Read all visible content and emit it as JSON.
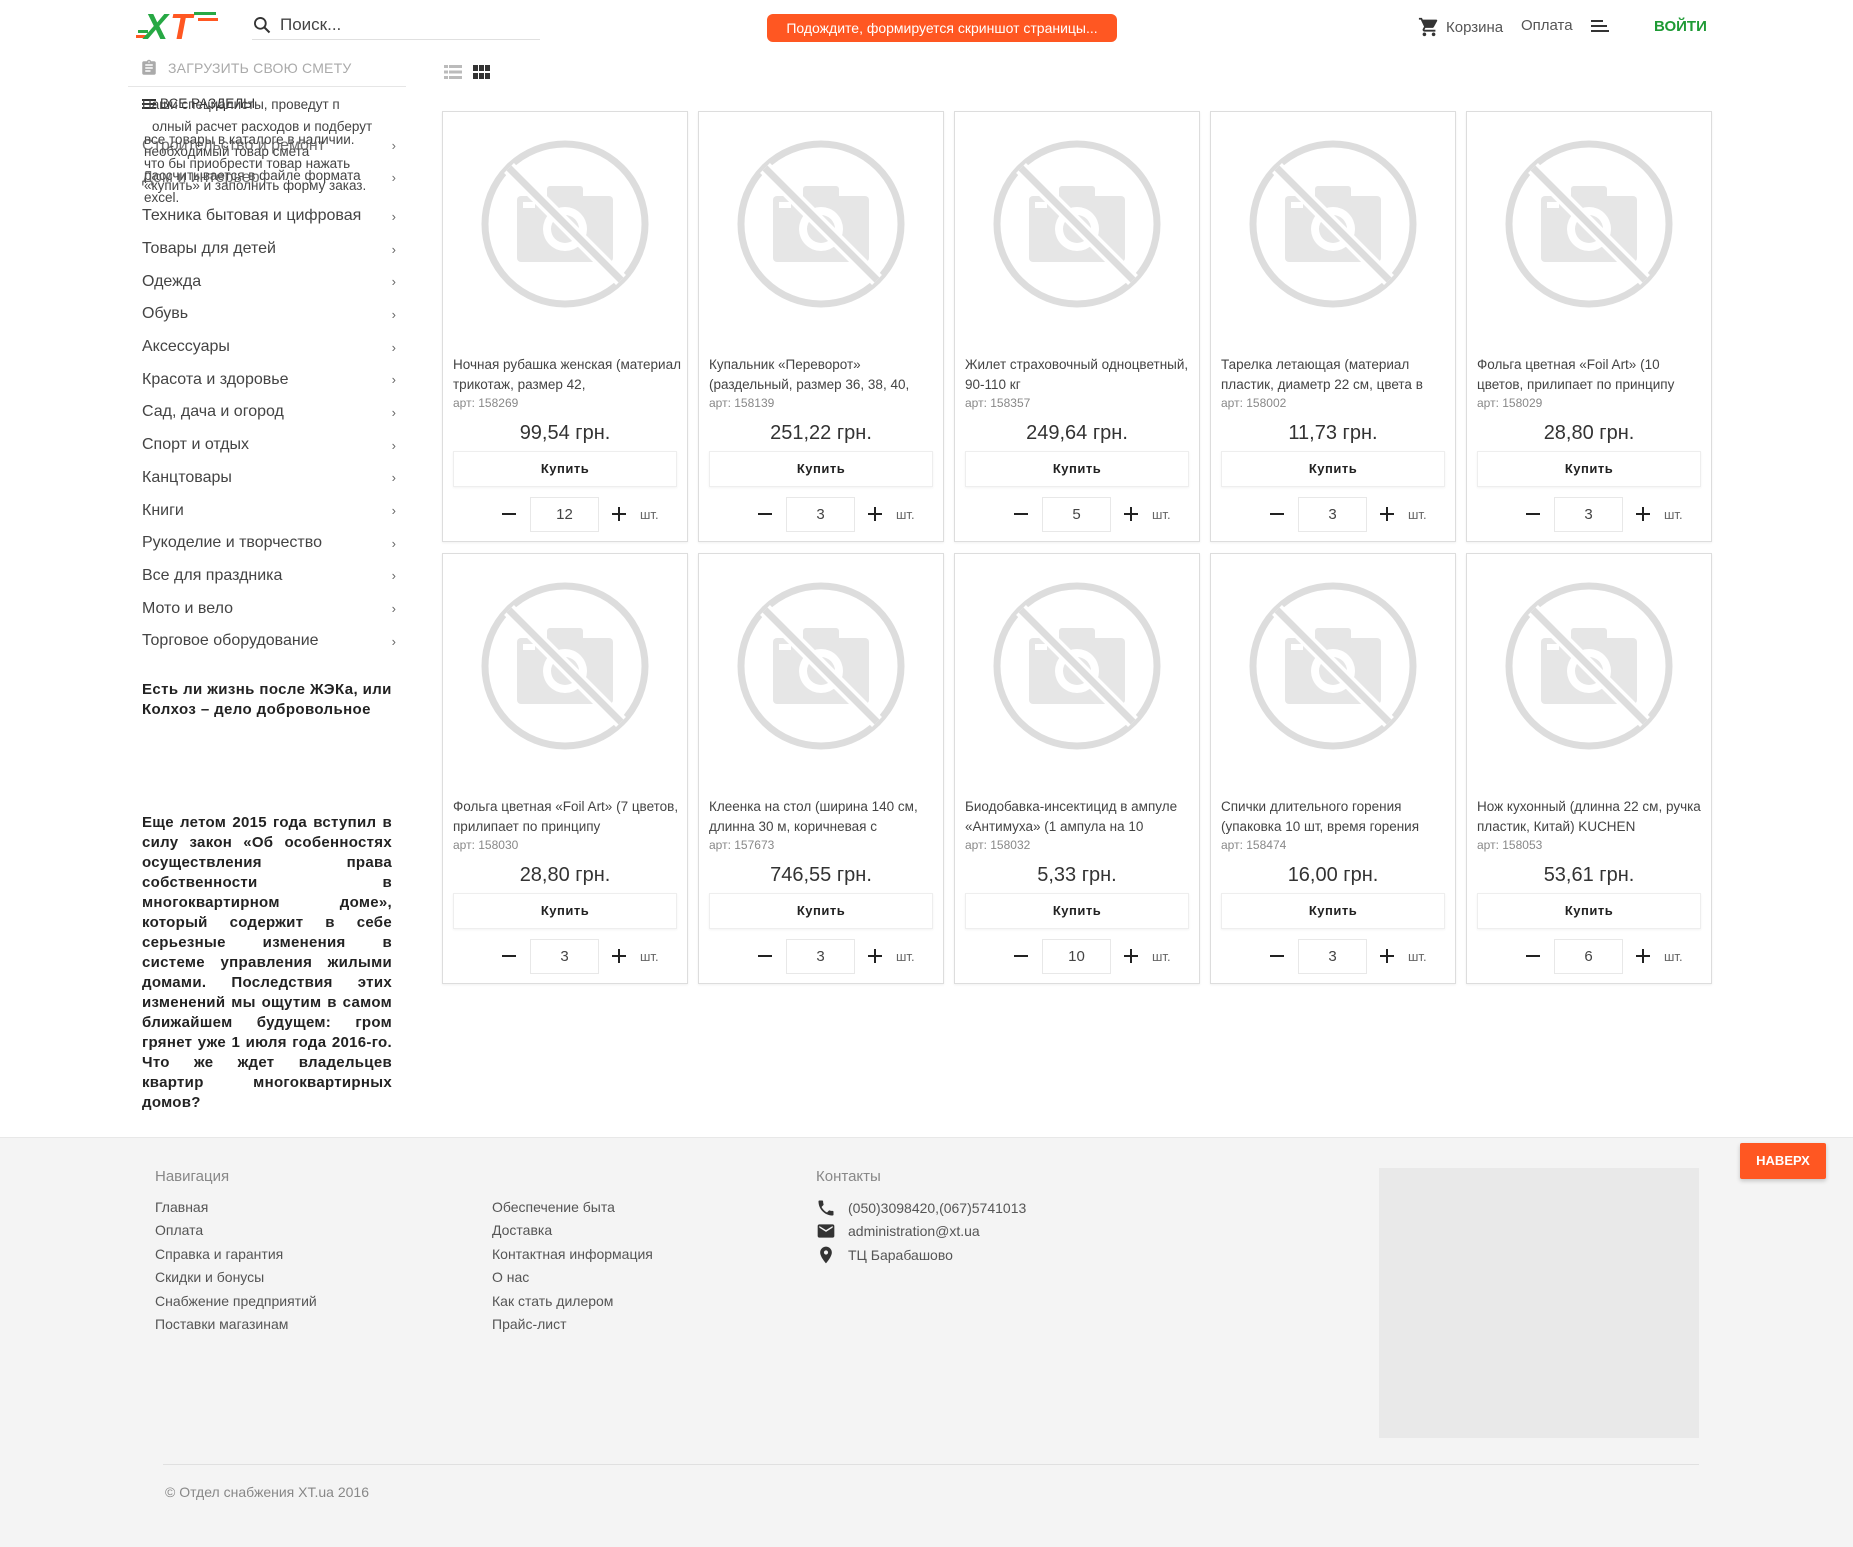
{
  "header": {
    "logo_text": "XT",
    "search_placeholder": "Поиск...",
    "notice": "Подождите, формируется скриншот страницы...",
    "cart_label": "Корзина",
    "payment_label": "Оплата",
    "login_label": "ВОЙТИ"
  },
  "sidebar": {
    "upload_label": "ЗАГРУЗИТЬ СВОЮ СМЕТУ",
    "all_sections_label": "ВСЕ РАЗДЕЛЫ",
    "overlap_text_lines": [
      "Наши специалисты, проведут п",
      "олный расчет расходов и подберут",
      "все товары в каталоге в наличии.",
      "что бы приобрести товар нажать",
      "«купить» и заполнить форму заказ."
    ],
    "overlap_text_lines2": [
      "необходимый товар смета",
      "рассчитывается в файле формата",
      "excel."
    ],
    "categories_hidden": [
      "Строительство и ремонт",
      "Дом и интерьер"
    ],
    "categories": [
      "Техника бытовая и цифровая",
      "Товары для детей",
      "Одежда",
      "Обувь",
      "Аксессуары",
      "Красота и здоровье",
      "Сад, дача и огород",
      "Спорт и отдых",
      "Канцтовары",
      "Книги",
      "Рукоделие и творчество",
      "Все для праздника",
      "Мото и вело",
      "Торговое оборудование"
    ],
    "article_title": "Есть ли жизнь после ЖЭКа, или Колхоз – дело добровольное",
    "article_body": "Еще летом 2015 года вступил в силу закон «Об особенностях осуществления права собственности в многоквартирном доме», который содержит в себе серьезные изменения в системе управления жилыми домами. Последствия этих изменений мы ощутим в самом ближайшем будущем: гром грянет уже 1 июля года 2016-го. Что же ждет владельцев квартир многоквартирных домов?"
  },
  "products": [
    {
      "name": "Ночная рубашка женская (материал трикотаж, размер 42,",
      "art": "арт: 158269",
      "price": "99,54 грн.",
      "qty": "12"
    },
    {
      "name": "Купальник «Переворот» (раздельный, размер 36, 38, 40,",
      "art": "арт: 158139",
      "price": "251,22 грн.",
      "qty": "3"
    },
    {
      "name": "Жилет страховочный одноцветный, 90-110 кг",
      "art": "арт: 158357",
      "price": "249,64 грн.",
      "qty": "5"
    },
    {
      "name": "Тарелка летающая (материал пластик, диаметр 22 см, цвета в",
      "art": "арт: 158002",
      "price": "11,73 грн.",
      "qty": "3"
    },
    {
      "name": "Фольга цветная «Foil Art» (10 цветов, прилипает по принципу",
      "art": "арт: 158029",
      "price": "28,80 грн.",
      "qty": "3"
    },
    {
      "name": "Фольга цветная «Foil Art» (7 цветов, прилипает по принципу",
      "art": "арт: 158030",
      "price": "28,80 грн.",
      "qty": "3"
    },
    {
      "name": "Клеенка на стол (ширина 140 см, длинна 30 м, коричневая с",
      "art": "арт: 157673",
      "price": "746,55 грн.",
      "qty": "3"
    },
    {
      "name": "Биодобавка-инсектицид в ампуле «Антимуха» (1 ампула на 10",
      "art": "арт: 158032",
      "price": "5,33 грн.",
      "qty": "10"
    },
    {
      "name": "Спички длительного горения (упаковка 10 шт, время горения",
      "art": "арт: 158474",
      "price": "16,00 грн.",
      "qty": "3"
    },
    {
      "name": "Нож кухонный (длинна 22 см, ручка пластик, Китай) KUCHEN",
      "art": "арт: 158053",
      "price": "53,61 грн.",
      "qty": "6"
    }
  ],
  "product_labels": {
    "buy": "Купить",
    "unit": "шт."
  },
  "footer": {
    "nav_title": "Навигация",
    "nav_col1": [
      "Главная",
      "Оплата",
      "Справка и гарантия",
      "Скидки и бонусы",
      "Снабжение предприятий",
      "Поставки магазинам"
    ],
    "nav_col2": [
      "Обеспечение быта",
      "Доставка",
      "Контактная информация",
      "О нас",
      "Как стать дилером",
      "Прайс-лист"
    ],
    "contacts_title": "Контакты",
    "phone": "(050)3098420,(067)5741013",
    "email": "administration@xt.ua",
    "address": "ТЦ Барабашово",
    "copyright": "© Отдел снабжения XT.ua 2016",
    "to_top": "НАВЕРХ"
  },
  "colors": {
    "accent": "#ff5722",
    "login_green": "#1e9a34",
    "logo_green": "#27a844"
  }
}
